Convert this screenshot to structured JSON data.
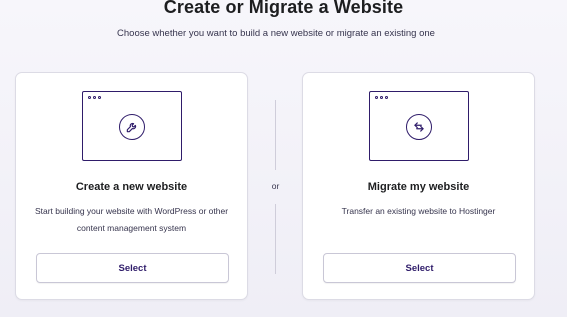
{
  "page": {
    "title": "Create or Migrate a Website",
    "subtitle": "Choose whether you want to build a new website or migrate an existing one"
  },
  "divider": {
    "label": "or"
  },
  "cards": [
    {
      "icon": "wrench-icon",
      "title": "Create a new website",
      "description": "Start building your website with WordPress or other content management system",
      "button_label": "Select"
    },
    {
      "icon": "swap-arrows-icon",
      "title": "Migrate my website",
      "description": "Transfer an existing website to Hostinger",
      "button_label": "Select"
    }
  ],
  "colors": {
    "accent": "#2f1c6a",
    "text": "#1d1e20",
    "muted_text": "#36344d",
    "card_border": "#dcdbe5",
    "background": "#f3f2f9"
  }
}
